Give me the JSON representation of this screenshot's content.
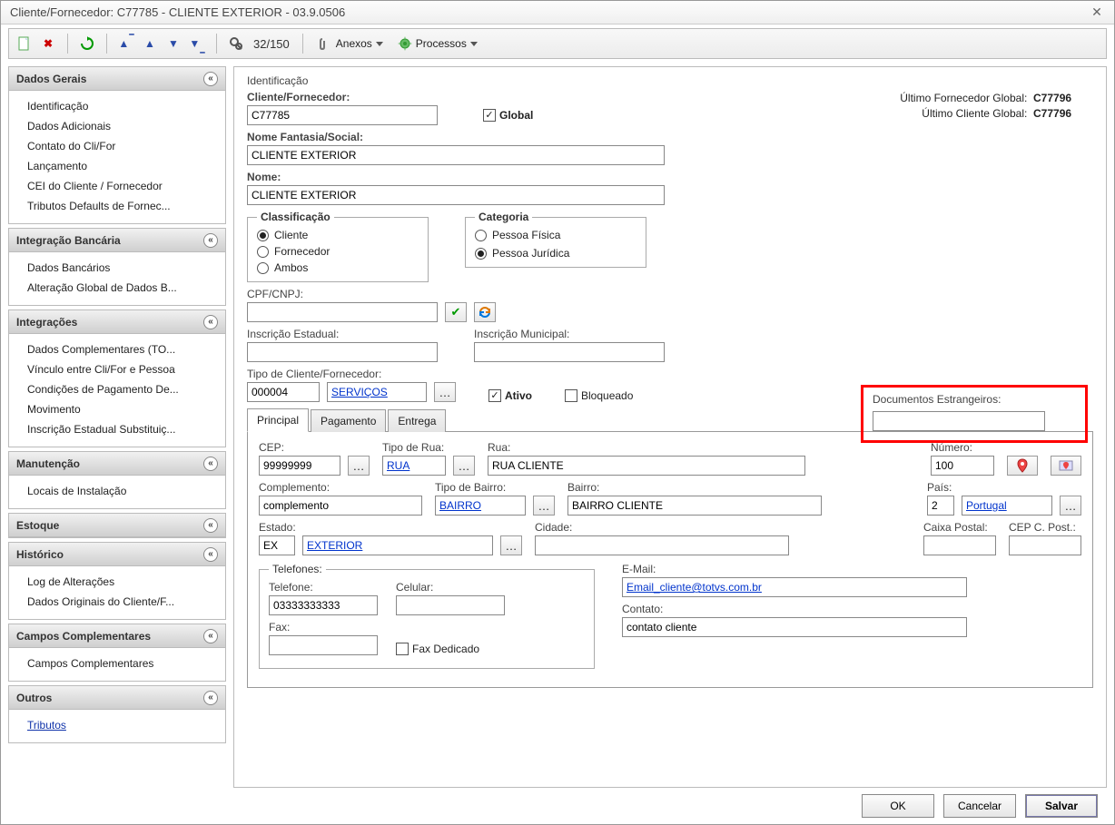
{
  "window": {
    "title": "Cliente/Fornecedor: C77785 - CLIENTE EXTERIOR - 03.9.0506"
  },
  "toolbar": {
    "record_counter": "32/150",
    "anexos_label": "Anexos",
    "processos_label": "Processos"
  },
  "sidebar": {
    "g1": {
      "title": "Dados Gerais",
      "items": [
        "Identificação",
        "Dados Adicionais",
        "Contato do Cli/For",
        "Lançamento",
        "CEI do Cliente / Fornecedor",
        "Tributos Defaults de Fornec..."
      ]
    },
    "g2": {
      "title": "Integração Bancária",
      "items": [
        "Dados Bancários",
        "Alteração Global de Dados B..."
      ]
    },
    "g3": {
      "title": "Integrações",
      "items": [
        "Dados Complementares (TO...",
        "Vínculo entre Cli/For e Pessoa",
        "Condições de Pagamento De...",
        "Movimento",
        "Inscrição Estadual Substituiç..."
      ]
    },
    "g4": {
      "title": "Manutenção",
      "items": [
        "Locais de Instalação"
      ]
    },
    "g5": {
      "title": "Estoque",
      "items": []
    },
    "g6": {
      "title": "Histórico",
      "items": [
        "Log de Alterações",
        "Dados Originais do Cliente/F..."
      ]
    },
    "g7": {
      "title": "Campos Complementares",
      "items": [
        "Campos Complementares"
      ]
    },
    "g8": {
      "title": "Outros",
      "items_links": [
        "Tributos"
      ]
    }
  },
  "main": {
    "section_title": "Identificação",
    "labels": {
      "cliente_fornecedor": "Cliente/Fornecedor:",
      "global": "Global",
      "nome_fantasia": "Nome Fantasia/Social:",
      "nome": "Nome:",
      "classificacao": "Classificação",
      "cliente": "Cliente",
      "fornecedor": "Fornecedor",
      "ambos": "Ambos",
      "categoria": "Categoria",
      "pessoa_fisica": "Pessoa Física",
      "pessoa_juridica": "Pessoa Jurídica",
      "cpf_cnpj": "CPF/CNPJ:",
      "inscricao_estadual": "Inscrição Estadual:",
      "inscricao_municipal": "Inscrição Municipal:",
      "tipo_cli_for": "Tipo de Cliente/Fornecedor:",
      "ativo": "Ativo",
      "bloqueado": "Bloqueado",
      "documentos_estrangeiros": "Documentos Estrangeiros:",
      "ultimo_fornecedor_global": "Último Fornecedor Global:",
      "ultimo_cliente_global": "Último Cliente Global:"
    },
    "values": {
      "cliente_fornecedor": "C77785",
      "global_checked": true,
      "nome_fantasia": "CLIENTE EXTERIOR",
      "nome": "CLIENTE EXTERIOR",
      "classificacao_sel": "cliente",
      "categoria_sel": "pj",
      "cpf_cnpj": "",
      "inscricao_estadual": "",
      "inscricao_municipal": "",
      "tipo_cli_for_code": "000004",
      "tipo_cli_for_desc": "SERVIÇOS",
      "ativo_checked": true,
      "bloqueado_checked": false,
      "documentos_estrangeiros": "",
      "ultimo_fornecedor_global": "C77796",
      "ultimo_cliente_global": "C77796"
    },
    "tabs": {
      "principal": "Principal",
      "pagamento": "Pagamento",
      "entrega": "Entrega"
    },
    "principal": {
      "labels": {
        "cep": "CEP:",
        "tipo_rua": "Tipo de Rua:",
        "rua": "Rua:",
        "numero": "Número:",
        "complemento": "Complemento:",
        "tipo_bairro": "Tipo de Bairro:",
        "bairro": "Bairro:",
        "pais": "País:",
        "estado": "Estado:",
        "cidade": "Cidade:",
        "caixa_postal": "Caixa Postal:",
        "cep_c_post": "CEP C. Post.:",
        "telefones": "Telefones:",
        "telefone": "Telefone:",
        "celular": "Celular:",
        "fax": "Fax:",
        "fax_dedicado": "Fax Dedicado",
        "email": "E-Mail:",
        "contato": "Contato:"
      },
      "values": {
        "cep": "99999999",
        "tipo_rua": "RUA",
        "rua": "RUA CLIENTE",
        "numero": "100",
        "complemento": "complemento",
        "tipo_bairro": "BAIRRO",
        "bairro": "BAIRRO CLIENTE",
        "pais_code": "2",
        "pais_name": "Portugal",
        "estado_code": "EX",
        "estado_name": "EXTERIOR",
        "cidade": "",
        "caixa_postal": "",
        "cep_c_post": "",
        "telefone": "03333333333",
        "celular": "",
        "fax": "",
        "fax_dedicado_checked": false,
        "email": "Email_cliente@totvs.com.br",
        "contato": "contato cliente"
      }
    }
  },
  "footer": {
    "ok": "OK",
    "cancelar": "Cancelar",
    "salvar": "Salvar"
  }
}
